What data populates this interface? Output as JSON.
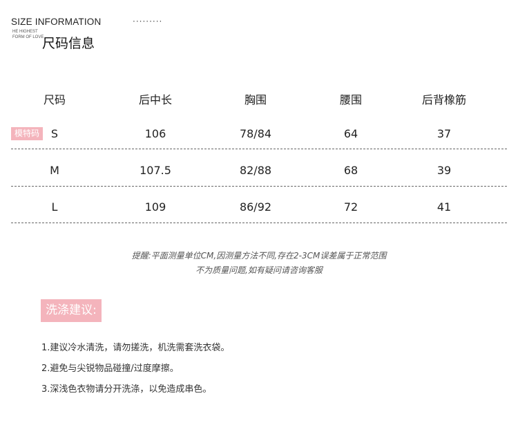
{
  "header": {
    "title_en": "SIZE INFORMATION",
    "dots": "·········",
    "small_line1": "HE HIGHEST",
    "small_line2": "FORM OF LOVE",
    "title_cn": "尺码信息"
  },
  "size_table": {
    "columns": [
      "尺码",
      "后中长",
      "胸围",
      "腰围",
      "后背橡筋"
    ],
    "model_tag": "模特码",
    "rows": [
      [
        "S",
        "106",
        "78/84",
        "64",
        "37"
      ],
      [
        "M",
        "107.5",
        "82/88",
        "68",
        "39"
      ],
      [
        "L",
        "109",
        "86/92",
        "72",
        "41"
      ]
    ]
  },
  "note": {
    "line1": "提醒:平面测量单位CM,因测量方法不同,存在2-3CM误差属于正常范围",
    "line2": "不为质量问题,如有疑问请咨询客服"
  },
  "washing": {
    "title": "洗涤建议:",
    "items": [
      "1.建议冷水清洗，请勿搓洗，机洗需套洗衣袋。",
      "2.避免与尖锐物品碰撞/过度摩擦。",
      "3.深浅色衣物请分开洗涤，以免造成串色。"
    ]
  },
  "colors": {
    "accent_pink": "#f4b4bc",
    "text": "#222222"
  }
}
